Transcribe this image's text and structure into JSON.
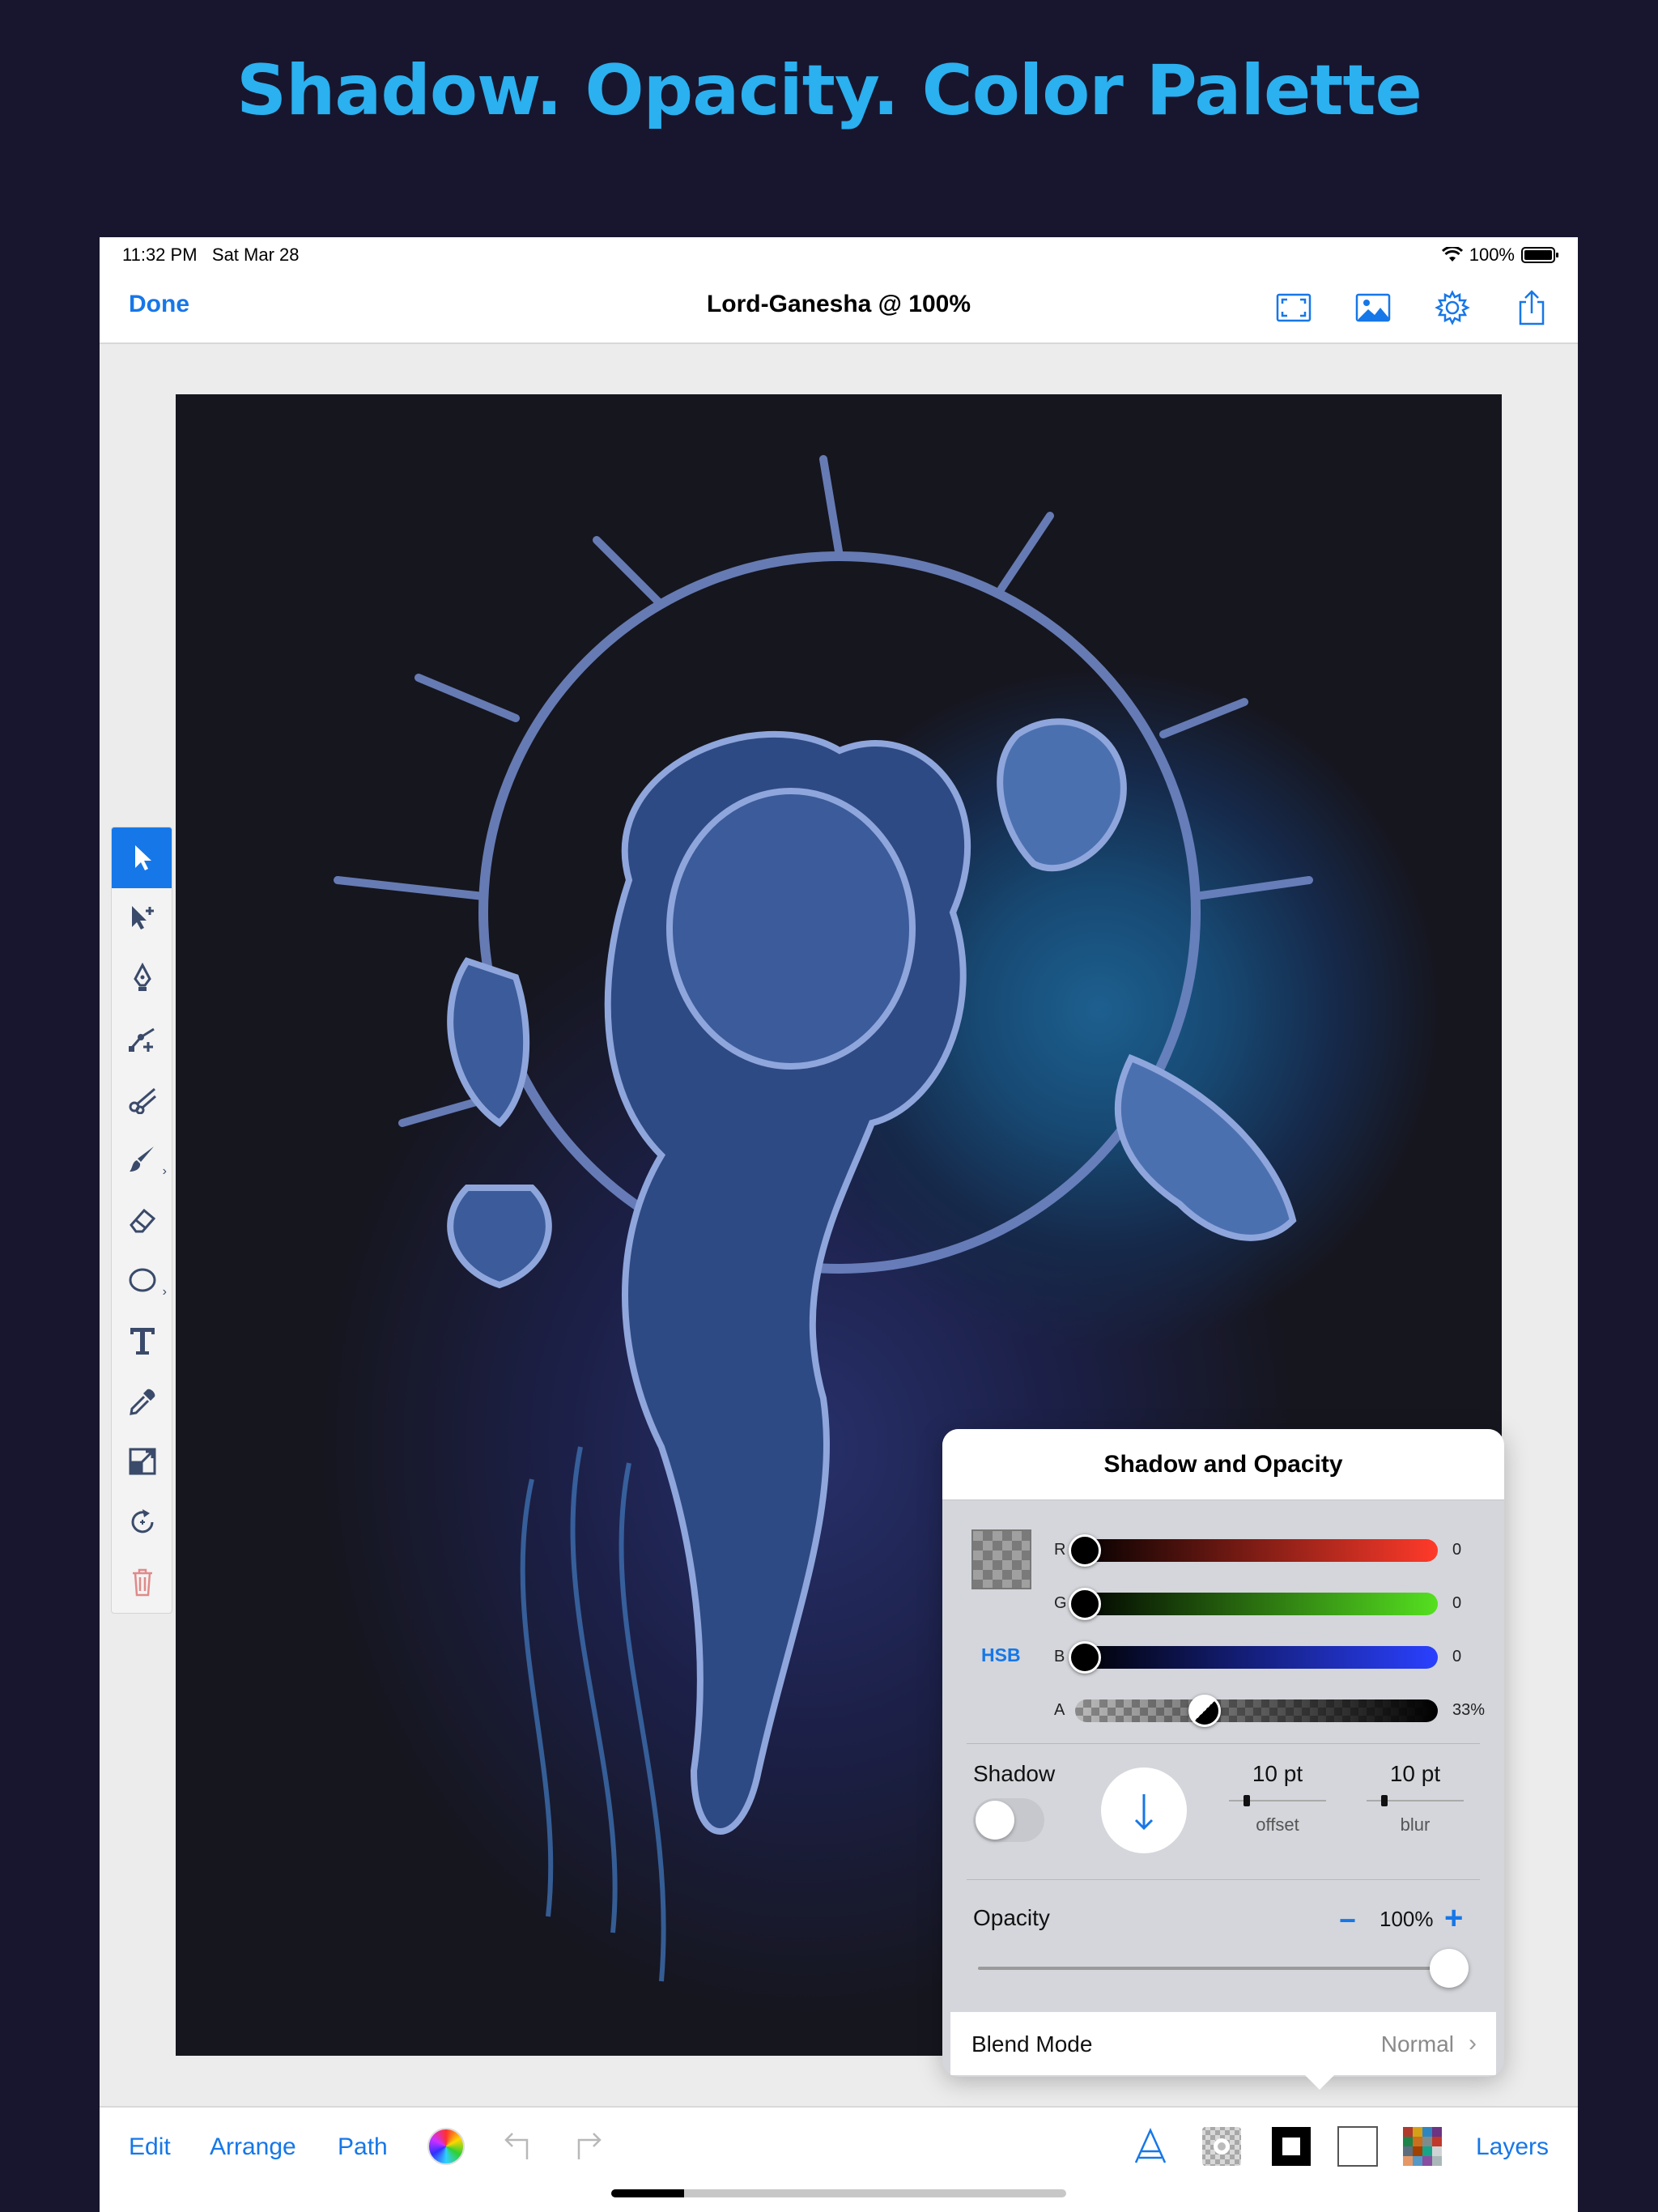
{
  "headline": "Shadow. Opacity. Color Palette",
  "status": {
    "time": "11:32 PM",
    "date": "Sat Mar 28",
    "battery": "100%"
  },
  "nav": {
    "done": "Done",
    "title": "Lord-Ganesha @ 100%"
  },
  "panel": {
    "title": "Shadow and Opacity",
    "rgba": [
      {
        "label": "R",
        "value": "0"
      },
      {
        "label": "G",
        "value": "0"
      },
      {
        "label": "B",
        "value": "0"
      },
      {
        "label": "A",
        "value": "33%"
      }
    ],
    "mode_button": "HSB",
    "shadow": {
      "label": "Shadow",
      "offset_value": "10 pt",
      "offset_label": "offset",
      "blur_value": "10 pt",
      "blur_label": "blur",
      "enabled": false
    },
    "opacity": {
      "label": "Opacity",
      "minus": "−",
      "value": "100%",
      "plus": "+",
      "level": 1.0
    },
    "blend": {
      "label": "Blend Mode",
      "value": "Normal"
    }
  },
  "bottom": {
    "edit": "Edit",
    "arrange": "Arrange",
    "path": "Path",
    "layers": "Layers"
  },
  "colors": {
    "accent": "#1677e8",
    "headline": "#2bb0f0",
    "background": "#18162e"
  }
}
